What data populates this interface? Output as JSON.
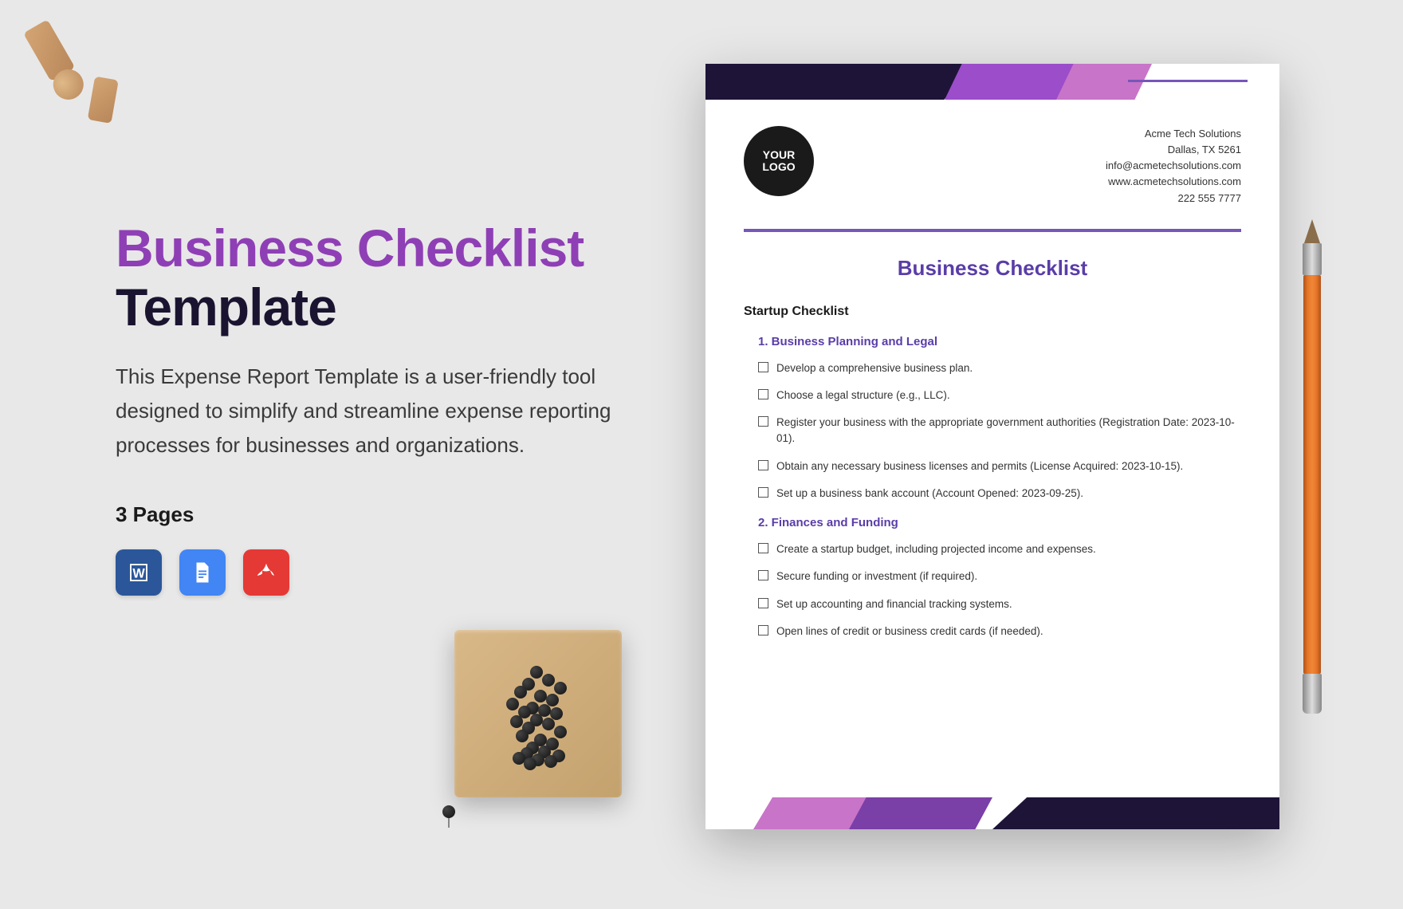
{
  "hero": {
    "title_line1": "Business Checklist",
    "title_line2": "Template",
    "description": "This Expense Report Template is a user-friendly tool designed to simplify and streamline expense reporting processes for businesses and organizations.",
    "pages_label": "3 Pages"
  },
  "file_formats": [
    "word",
    "gdocs",
    "pdf"
  ],
  "document": {
    "logo_line1": "YOUR",
    "logo_line2": "LOGO",
    "company": {
      "name": "Acme Tech Solutions",
      "address": "Dallas, TX 5261",
      "email": "info@acmetechsolutions.com",
      "website": "www.acmetechsolutions.com",
      "phone": "222 555 7777"
    },
    "title": "Business Checklist",
    "section_title": "Startup Checklist",
    "sections": [
      {
        "heading": "1.  Business Planning and Legal",
        "items": [
          "Develop a comprehensive business plan.",
          "Choose a legal structure (e.g., LLC).",
          "Register your business with the appropriate government authorities (Registration Date: 2023-10-01).",
          "Obtain any necessary business licenses and permits (License Acquired: 2023-10-15).",
          "Set up a business bank account (Account Opened: 2023-09-25)."
        ]
      },
      {
        "heading": "2.  Finances and Funding",
        "items": [
          "Create a startup budget, including projected income and expenses.",
          "Secure funding or investment (if required).",
          "Set up accounting and financial tracking systems.",
          "Open lines of credit or business credit cards (if needed)."
        ]
      }
    ]
  },
  "colors": {
    "purple": "#8f3fb5",
    "dark": "#1a1430",
    "doc_accent": "#5a3da8"
  }
}
